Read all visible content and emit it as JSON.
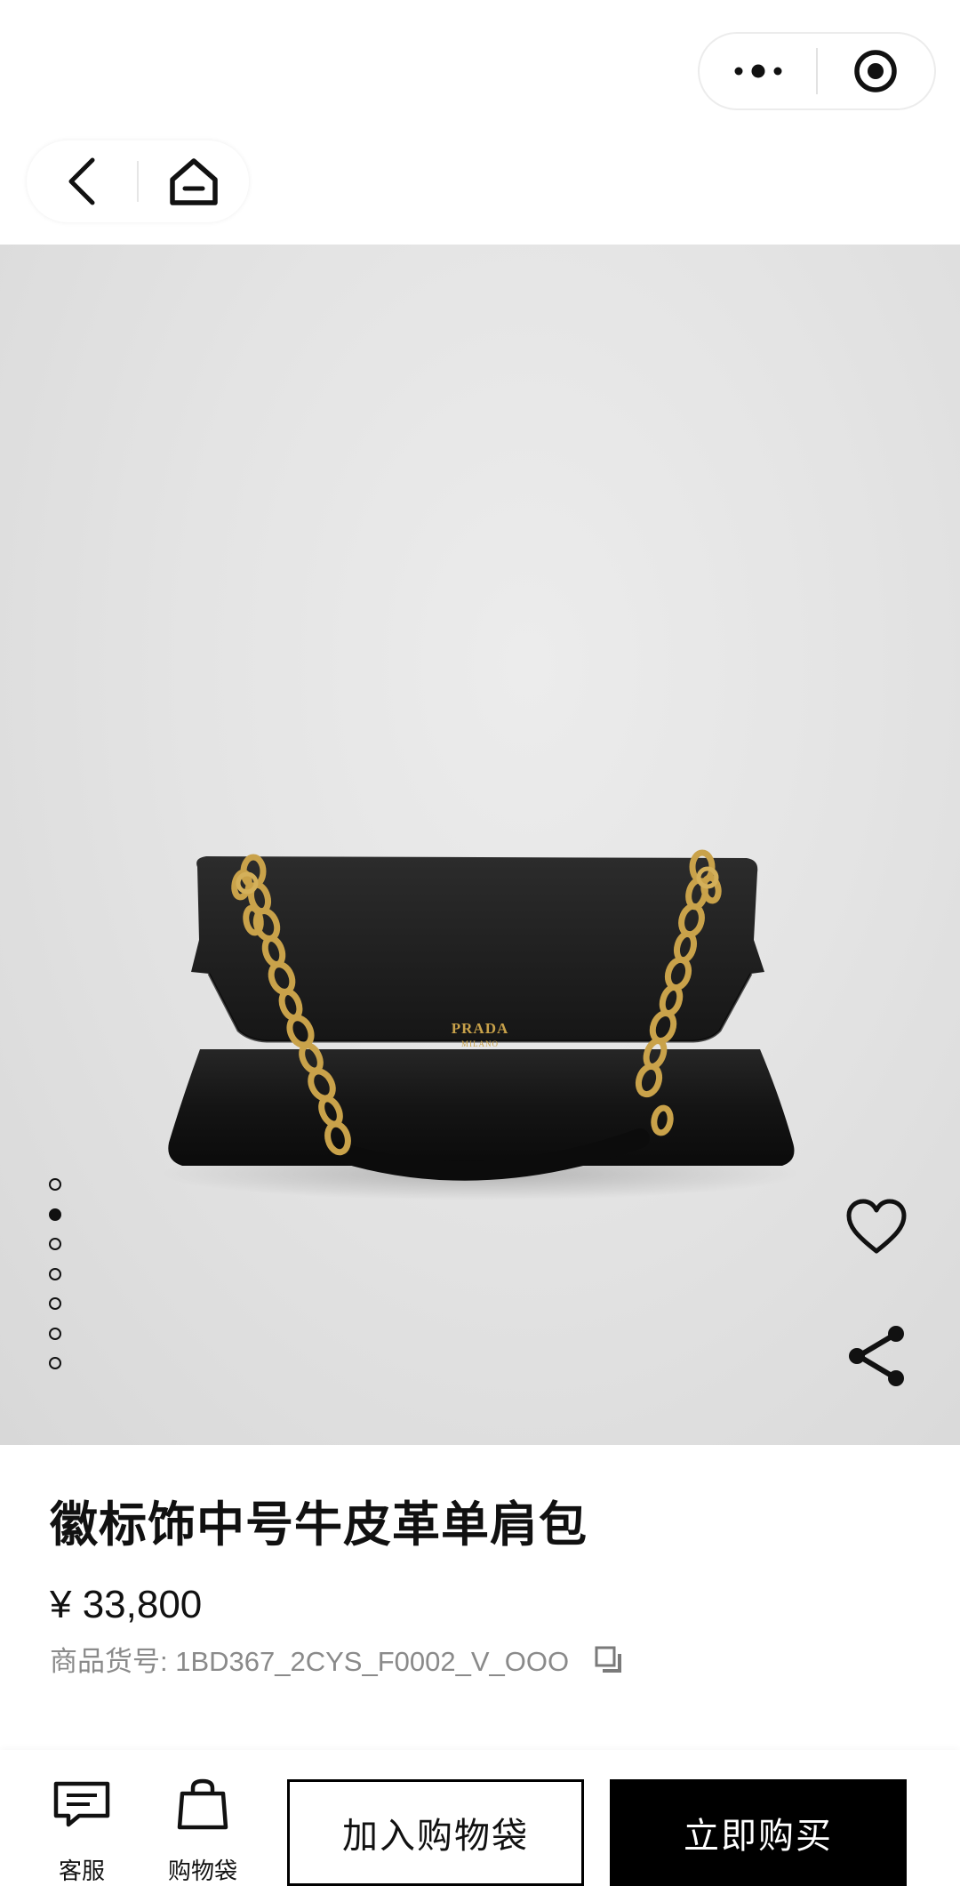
{
  "top_bar": {
    "icons": [
      "more-icon",
      "target-icon"
    ]
  },
  "nav": {
    "icons": [
      "back-chevron-icon",
      "home-icon"
    ]
  },
  "gallery": {
    "image_count": 7,
    "active_index": 1,
    "brand_logo": "PRADA",
    "brand_sub": "MILANO",
    "background_color": "#e4e4e4",
    "bag_color": "#151515",
    "chain_color": "#c9a24a"
  },
  "product": {
    "title": "徽标饰中号牛皮革单肩包",
    "price": "¥ 33,800",
    "sku": "商品货号: 1BD367_2CYS_F0002_V_OOO"
  },
  "bottom_bar": {
    "service_label": "客服",
    "bag_label": "购物袋",
    "add_to_bag_label": "加入购物袋",
    "buy_now_label": "立即购买"
  }
}
